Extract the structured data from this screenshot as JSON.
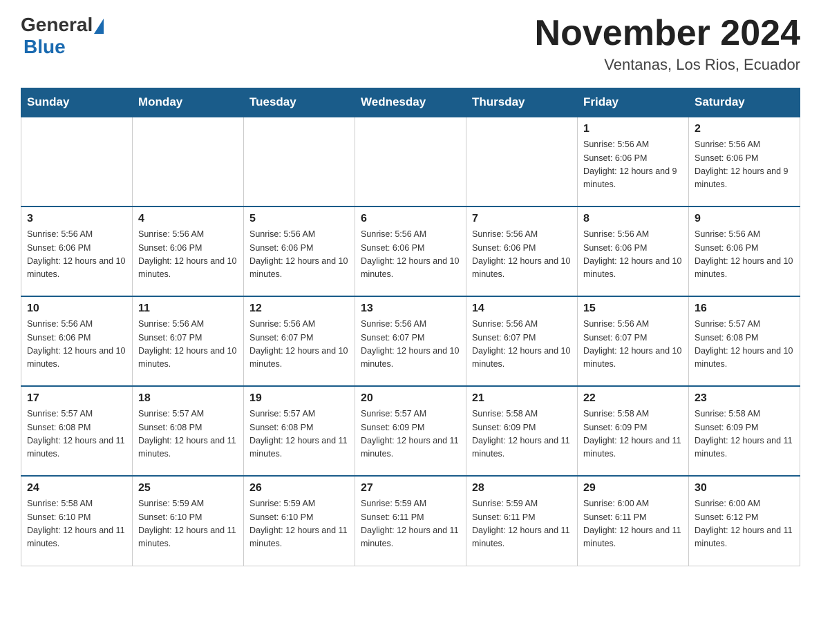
{
  "logo": {
    "general": "General",
    "blue": "Blue"
  },
  "header": {
    "month_title": "November 2024",
    "location": "Ventanas, Los Rios, Ecuador"
  },
  "days_of_week": [
    "Sunday",
    "Monday",
    "Tuesday",
    "Wednesday",
    "Thursday",
    "Friday",
    "Saturday"
  ],
  "weeks": [
    [
      {
        "day": "",
        "info": ""
      },
      {
        "day": "",
        "info": ""
      },
      {
        "day": "",
        "info": ""
      },
      {
        "day": "",
        "info": ""
      },
      {
        "day": "",
        "info": ""
      },
      {
        "day": "1",
        "info": "Sunrise: 5:56 AM\nSunset: 6:06 PM\nDaylight: 12 hours and 9 minutes."
      },
      {
        "day": "2",
        "info": "Sunrise: 5:56 AM\nSunset: 6:06 PM\nDaylight: 12 hours and 9 minutes."
      }
    ],
    [
      {
        "day": "3",
        "info": "Sunrise: 5:56 AM\nSunset: 6:06 PM\nDaylight: 12 hours and 10 minutes."
      },
      {
        "day": "4",
        "info": "Sunrise: 5:56 AM\nSunset: 6:06 PM\nDaylight: 12 hours and 10 minutes."
      },
      {
        "day": "5",
        "info": "Sunrise: 5:56 AM\nSunset: 6:06 PM\nDaylight: 12 hours and 10 minutes."
      },
      {
        "day": "6",
        "info": "Sunrise: 5:56 AM\nSunset: 6:06 PM\nDaylight: 12 hours and 10 minutes."
      },
      {
        "day": "7",
        "info": "Sunrise: 5:56 AM\nSunset: 6:06 PM\nDaylight: 12 hours and 10 minutes."
      },
      {
        "day": "8",
        "info": "Sunrise: 5:56 AM\nSunset: 6:06 PM\nDaylight: 12 hours and 10 minutes."
      },
      {
        "day": "9",
        "info": "Sunrise: 5:56 AM\nSunset: 6:06 PM\nDaylight: 12 hours and 10 minutes."
      }
    ],
    [
      {
        "day": "10",
        "info": "Sunrise: 5:56 AM\nSunset: 6:06 PM\nDaylight: 12 hours and 10 minutes."
      },
      {
        "day": "11",
        "info": "Sunrise: 5:56 AM\nSunset: 6:07 PM\nDaylight: 12 hours and 10 minutes."
      },
      {
        "day": "12",
        "info": "Sunrise: 5:56 AM\nSunset: 6:07 PM\nDaylight: 12 hours and 10 minutes."
      },
      {
        "day": "13",
        "info": "Sunrise: 5:56 AM\nSunset: 6:07 PM\nDaylight: 12 hours and 10 minutes."
      },
      {
        "day": "14",
        "info": "Sunrise: 5:56 AM\nSunset: 6:07 PM\nDaylight: 12 hours and 10 minutes."
      },
      {
        "day": "15",
        "info": "Sunrise: 5:56 AM\nSunset: 6:07 PM\nDaylight: 12 hours and 10 minutes."
      },
      {
        "day": "16",
        "info": "Sunrise: 5:57 AM\nSunset: 6:08 PM\nDaylight: 12 hours and 10 minutes."
      }
    ],
    [
      {
        "day": "17",
        "info": "Sunrise: 5:57 AM\nSunset: 6:08 PM\nDaylight: 12 hours and 11 minutes."
      },
      {
        "day": "18",
        "info": "Sunrise: 5:57 AM\nSunset: 6:08 PM\nDaylight: 12 hours and 11 minutes."
      },
      {
        "day": "19",
        "info": "Sunrise: 5:57 AM\nSunset: 6:08 PM\nDaylight: 12 hours and 11 minutes."
      },
      {
        "day": "20",
        "info": "Sunrise: 5:57 AM\nSunset: 6:09 PM\nDaylight: 12 hours and 11 minutes."
      },
      {
        "day": "21",
        "info": "Sunrise: 5:58 AM\nSunset: 6:09 PM\nDaylight: 12 hours and 11 minutes."
      },
      {
        "day": "22",
        "info": "Sunrise: 5:58 AM\nSunset: 6:09 PM\nDaylight: 12 hours and 11 minutes."
      },
      {
        "day": "23",
        "info": "Sunrise: 5:58 AM\nSunset: 6:09 PM\nDaylight: 12 hours and 11 minutes."
      }
    ],
    [
      {
        "day": "24",
        "info": "Sunrise: 5:58 AM\nSunset: 6:10 PM\nDaylight: 12 hours and 11 minutes."
      },
      {
        "day": "25",
        "info": "Sunrise: 5:59 AM\nSunset: 6:10 PM\nDaylight: 12 hours and 11 minutes."
      },
      {
        "day": "26",
        "info": "Sunrise: 5:59 AM\nSunset: 6:10 PM\nDaylight: 12 hours and 11 minutes."
      },
      {
        "day": "27",
        "info": "Sunrise: 5:59 AM\nSunset: 6:11 PM\nDaylight: 12 hours and 11 minutes."
      },
      {
        "day": "28",
        "info": "Sunrise: 5:59 AM\nSunset: 6:11 PM\nDaylight: 12 hours and 11 minutes."
      },
      {
        "day": "29",
        "info": "Sunrise: 6:00 AM\nSunset: 6:11 PM\nDaylight: 12 hours and 11 minutes."
      },
      {
        "day": "30",
        "info": "Sunrise: 6:00 AM\nSunset: 6:12 PM\nDaylight: 12 hours and 11 minutes."
      }
    ]
  ]
}
